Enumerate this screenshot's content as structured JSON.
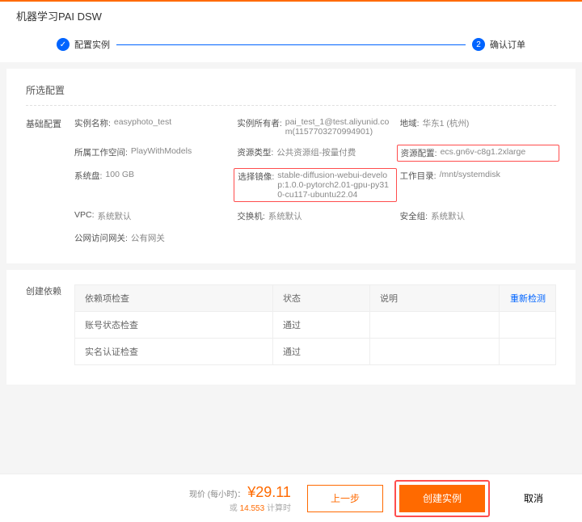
{
  "header": {
    "title": "机器学习PAI DSW"
  },
  "steps": {
    "s1": "配置实例",
    "s2": "确认订单",
    "num2": "2"
  },
  "panel1": {
    "title": "所选配置",
    "section": "基础配置"
  },
  "fields": {
    "name_l": "实例名称:",
    "name_v": "easyphoto_test",
    "owner_l": "实例所有者:",
    "owner_v": "pai_test_1@test.aliyunid.com(1157703270994901)",
    "region_l": "地域:",
    "region_v": "华东1 (杭州)",
    "ws_l": "所属工作空间:",
    "ws_v": "PlayWithModels",
    "rtype_l": "资源类型:",
    "rtype_v": "公共资源组-按量付费",
    "rcfg_l": "资源配置:",
    "rcfg_v": "ecs.gn6v-c8g1.2xlarge",
    "disk_l": "系统盘:",
    "disk_v": "100 GB",
    "img_l": "选择镜像:",
    "img_v": "stable-diffusion-webui-develop:1.0.0-pytorch2.01-gpu-py310-cu117-ubuntu22.04",
    "wdir_l": "工作目录:",
    "wdir_v": "/mnt/systemdisk",
    "vpc_l": "VPC:",
    "vpc_v": "系统默认",
    "switch_l": "交换机:",
    "switch_v": "系统默认",
    "sg_l": "安全组:",
    "sg_v": "系统默认",
    "gw_l": "公网访问网关:",
    "gw_v": "公有网关"
  },
  "deps": {
    "title": "创建依赖",
    "th1": "依赖项检查",
    "th2": "状态",
    "th3": "说明",
    "recheck": "重新检测",
    "r1": "账号状态检查",
    "r2": "实名认证检查",
    "pass": "通过"
  },
  "footer": {
    "price_label": "现价 (每小时)：",
    "currency": "¥",
    "price": "29.11",
    "sub1": "或 ",
    "sub2": "14.553 ",
    "sub3": "计算时",
    "prev": "上一步",
    "create": "创建实例",
    "cancel": "取消"
  }
}
